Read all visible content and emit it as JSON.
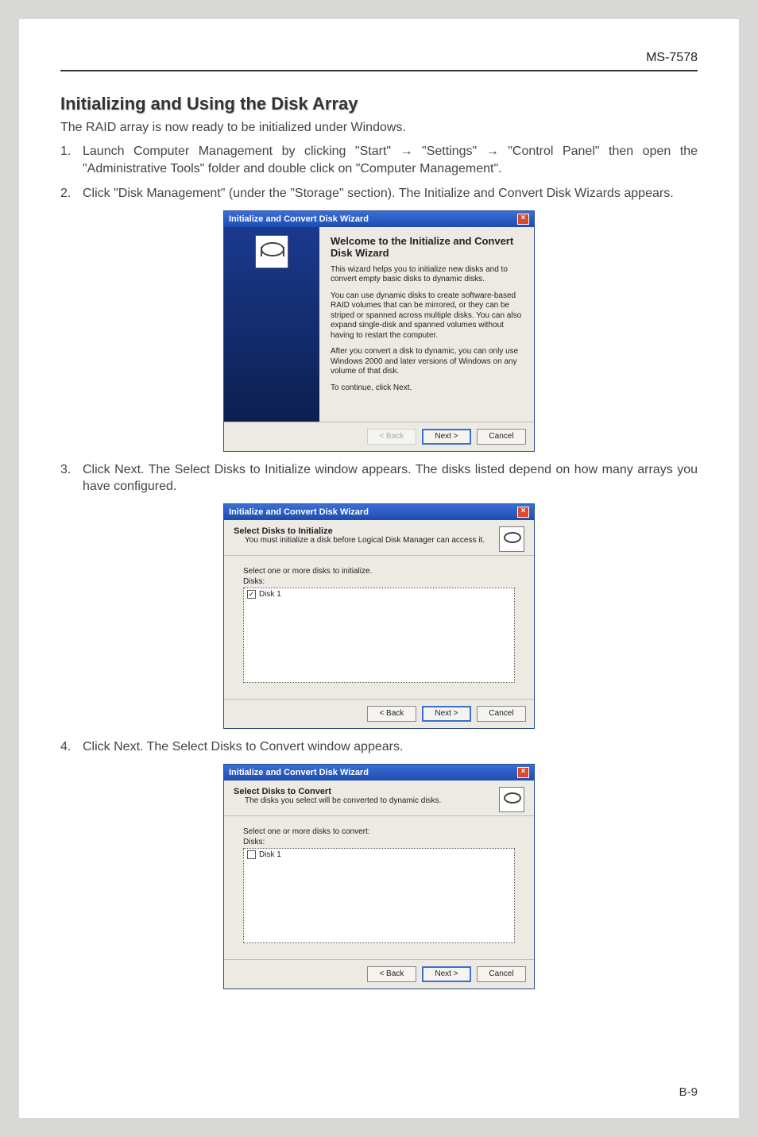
{
  "doc_code": "MS-7578",
  "section_title": "Initializing and Using the Disk Array",
  "intro": "The RAID array is now ready to be initialized under Windows.",
  "steps": [
    {
      "n": "1.",
      "text": "Launch Computer Management by clicking \"Start\" → \"Settings\" → \"Control Panel\" then open the \"Administrative Tools\" folder and double click on \"Computer Management\"."
    },
    {
      "n": "2.",
      "text": "Click \"Disk Management\" (under the \"Storage\" section). The Initialize and Convert Disk Wizards appears."
    },
    {
      "n": "3.",
      "text": "Click Next. The Select Disks to Initialize window appears. The disks listed depend on how many arrays you have configured."
    },
    {
      "n": "4.",
      "text": "Click Next. The Select Disks to Convert window appears."
    }
  ],
  "dlg1": {
    "title": "Initialize and Convert Disk Wizard",
    "heading": "Welcome to the Initialize and Convert Disk Wizard",
    "p1": "This wizard helps you to initialize new disks and to convert empty basic disks to dynamic disks.",
    "p2": "You can use dynamic disks to create software-based RAID volumes that can be mirrored, or they can be striped or spanned across multiple disks. You can also expand single-disk and spanned volumes without having to restart the computer.",
    "p3": "After you convert a disk to dynamic, you can only use Windows 2000 and later versions of Windows on any volume of that disk.",
    "p4": "To continue, click Next.",
    "back": "< Back",
    "next": "Next >",
    "cancel": "Cancel"
  },
  "dlg2": {
    "title": "Initialize and Convert Disk Wizard",
    "step_title": "Select Disks to Initialize",
    "step_sub": "You must initialize a disk before Logical Disk Manager can access it.",
    "prompt": "Select one or more disks to initialize.",
    "disks_label": "Disks:",
    "disk_item": "Disk 1",
    "checked": "✓",
    "back": "< Back",
    "next": "Next >",
    "cancel": "Cancel"
  },
  "dlg3": {
    "title": "Initialize and Convert Disk Wizard",
    "step_title": "Select Disks to Convert",
    "step_sub": "The disks you select will be converted to dynamic disks.",
    "prompt": "Select one or more disks to convert:",
    "disks_label": "Disks:",
    "disk_item": "Disk 1",
    "back": "< Back",
    "next": "Next >",
    "cancel": "Cancel"
  },
  "page_num": "B-9"
}
